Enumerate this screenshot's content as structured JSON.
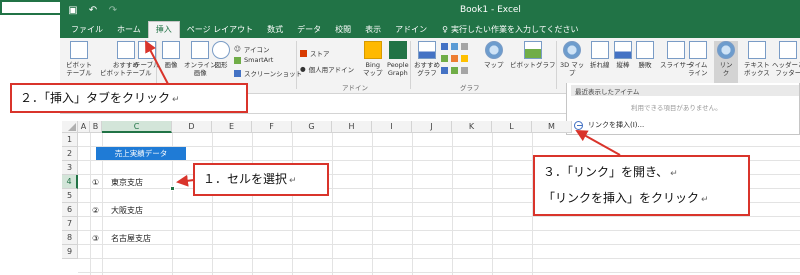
{
  "window": {
    "title": "Book1 - Excel",
    "qat_icons": [
      "save-icon",
      "undo-icon",
      "redo-icon"
    ]
  },
  "tabs": [
    "ファイル",
    "ホーム",
    "挿入",
    "ページ レイアウト",
    "数式",
    "データ",
    "校閲",
    "表示",
    "アドイン"
  ],
  "tell_me": "実行したい作業を入力してください",
  "ribbon": {
    "pivot": "ピボット\nテーブル",
    "rec_pivot": "おすすめ\nピボットテーブル",
    "table": "テーブル",
    "picture": "画像",
    "online_picture": "オンライン\n画像",
    "shapes": "図形",
    "icons": "アイコン",
    "smartart": "SmartArt",
    "screenshot": "スクリーンショット",
    "store": "ストア",
    "my_addins": "個人用アドイン",
    "bing_maps": "Bing\nマップ",
    "people_graph": "People\nGraph",
    "rec_charts": "おすすめ\nグラフ",
    "map": "マップ",
    "pivot_chart": "ピボットグラフ",
    "map3d": "3D マッ\nプ",
    "line": "折れ線",
    "column": "縦棒",
    "winloss": "勝敗",
    "slicer": "スライサー",
    "timeline": "タイム\nライン",
    "link": "リン\nク",
    "textbox": "テキスト\nボックス",
    "header_footer": "ヘッダーと\nフッター",
    "group_addin": "アドイン",
    "group_chart": "グラフ"
  },
  "link_menu": {
    "header": "最近表示したアイテム",
    "empty": "利用できる項目がありません。",
    "insert_link": "リンクを挿入(I)..."
  },
  "columns": [
    "A",
    "B",
    "C",
    "D",
    "E",
    "F",
    "G",
    "H",
    "I",
    "J",
    "K",
    "L",
    "M"
  ],
  "rows": [
    "1",
    "2",
    "3",
    "4",
    "5",
    "6",
    "7",
    "8",
    "9"
  ],
  "cells": {
    "c2": "売上実績データ",
    "b4": "①",
    "c4": "東京支店",
    "b6": "②",
    "c6": "大阪支店",
    "b8": "③",
    "c8": "名古屋支店"
  },
  "callouts": {
    "step1": "１．セルを選択",
    "step2": "２．「挿入」タブをクリック",
    "step3_line1": "３．「リンク」を開き、",
    "step3_line2": "「リンクを挿入」をクリック",
    "return_mark": "↵"
  },
  "colors": {
    "excel_green": "#217346",
    "callout_red": "#d9342b",
    "title_cell": "#1f7bd6"
  }
}
